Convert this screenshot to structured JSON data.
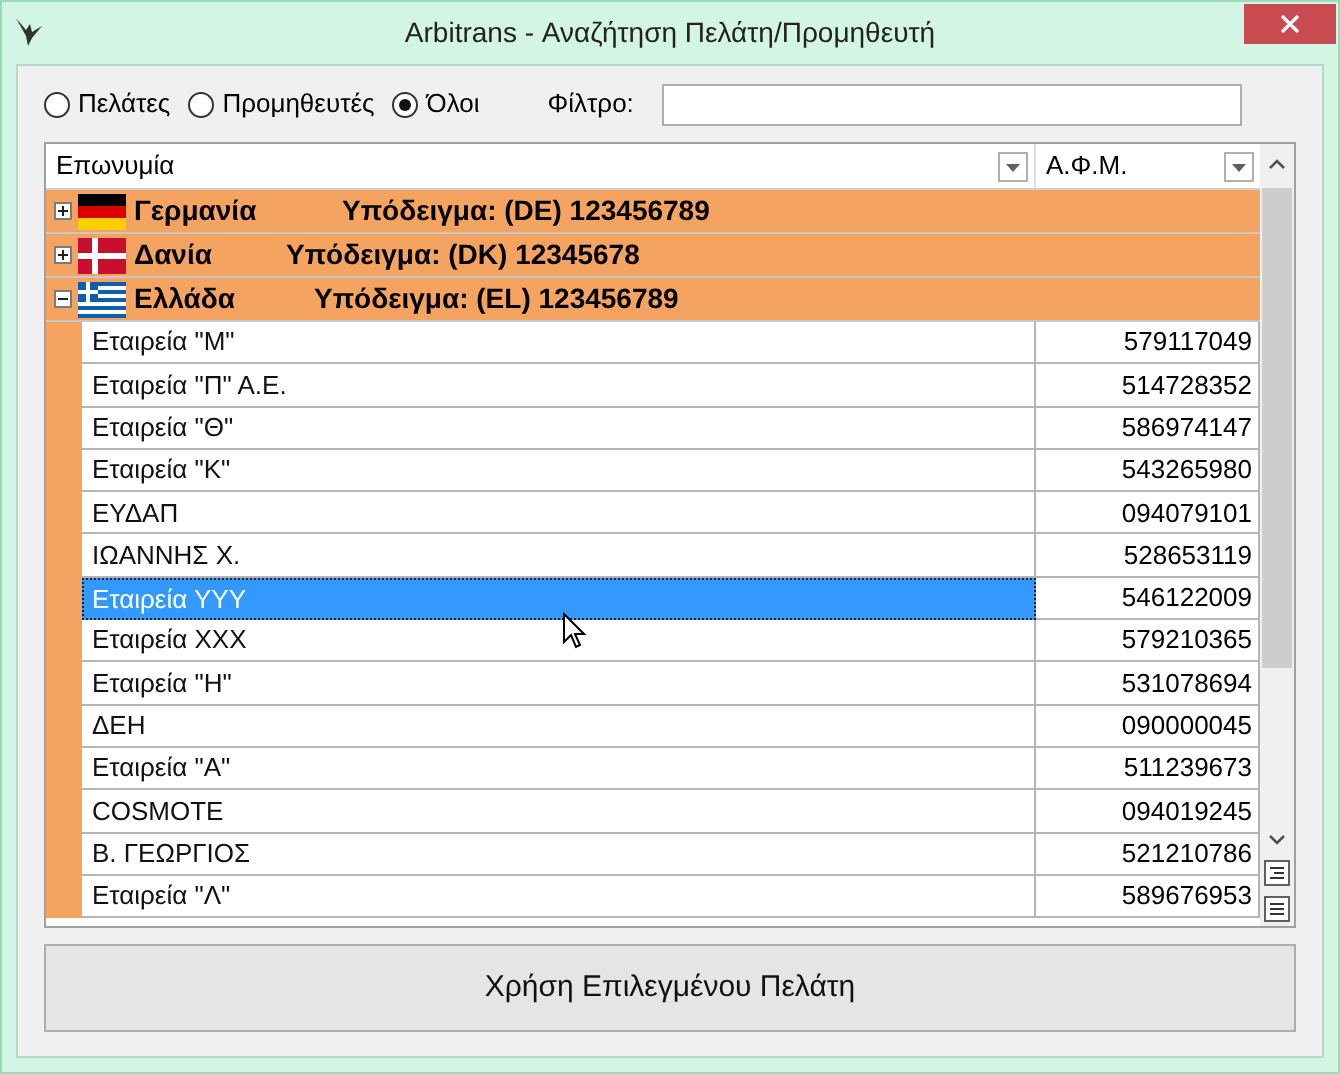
{
  "window": {
    "title": "Arbitrans - Αναζήτηση Πελάτη/Προμηθευτή"
  },
  "filter_options": [
    {
      "label": "Πελάτες",
      "selected": false
    },
    {
      "label": "Προμηθευτές",
      "selected": false
    },
    {
      "label": "Όλοι",
      "selected": true
    }
  ],
  "filter": {
    "label": "Φίλτρο:"
  },
  "table": {
    "columns": [
      "Επωνυμία",
      "Α.Φ.Μ."
    ],
    "groups": [
      {
        "country": "Γερμανία",
        "kind": "de",
        "example": "Υπόδειγμα: (DE) 123456789",
        "expanded": false
      },
      {
        "country": "Δανία",
        "kind": "dk",
        "example": "Υπόδειγμα: (DK) 12345678",
        "expanded": false
      },
      {
        "country": "Ελλάδα",
        "kind": "gr",
        "example": "Υπόδειγμα: (EL) 123456789",
        "expanded": true,
        "rows": [
          {
            "name": "Εταιρεία \"Μ\"",
            "afm": "579117049",
            "selected": false
          },
          {
            "name": "Εταιρεία \"Π\" Α.Ε.",
            "afm": "514728352",
            "selected": false
          },
          {
            "name": "Εταιρεία \"Θ\"",
            "afm": "586974147",
            "selected": false
          },
          {
            "name": "Εταιρεία \"Κ\"",
            "afm": "543265980",
            "selected": false
          },
          {
            "name": "ΕΥΔΑΠ",
            "afm": "094079101",
            "selected": false
          },
          {
            "name": "ΙΩΑΝΝΗΣ Χ.",
            "afm": "528653119",
            "selected": false
          },
          {
            "name": "Εταιρεία ΥΥΥ",
            "afm": "546122009",
            "selected": true
          },
          {
            "name": "Εταιρεία ΧΧΧ",
            "afm": "579210365",
            "selected": false
          },
          {
            "name": "Εταιρεία \"Η\"",
            "afm": "531078694",
            "selected": false
          },
          {
            "name": "ΔΕΗ",
            "afm": "090000045",
            "selected": false
          },
          {
            "name": "Εταιρεία \"Α\"",
            "afm": "511239673",
            "selected": false
          },
          {
            "name": "COSMOTE",
            "afm": "094019245",
            "selected": false
          },
          {
            "name": "Β. ΓΕΩΡΓΙΟΣ",
            "afm": "521210786",
            "selected": false
          },
          {
            "name": "Εταιρεία \"Λ\"",
            "afm": "589676953",
            "selected": false
          }
        ]
      }
    ]
  },
  "button": {
    "label": "Χρήση Επιλεγμένου Πελάτη"
  }
}
